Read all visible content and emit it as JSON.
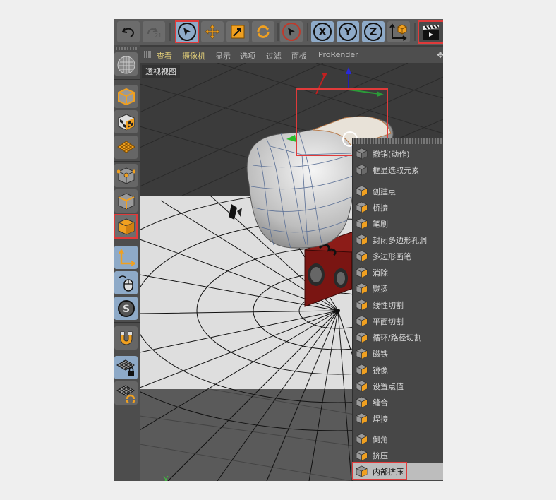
{
  "toolbar": {
    "undo_icon": "undo-icon",
    "redo_icon": "redo-icon",
    "tools": [
      "select-arrow-icon",
      "move-icon",
      "scale-icon",
      "rotate-icon",
      "live-select-icon"
    ],
    "axes": [
      "X",
      "Y",
      "Z"
    ],
    "coord_icon": "world-coordinate-icon",
    "render_icon": "clapper-render-icon"
  },
  "viewport_menu": {
    "items": [
      "查看",
      "摄像机",
      "显示",
      "选项",
      "过滤",
      "面板",
      "ProRender"
    ],
    "highlighted": [
      "查看",
      "摄像机"
    ]
  },
  "viewport": {
    "label": "透视视图"
  },
  "context_menu": {
    "groups": [
      [
        {
          "label": "撤销(动作)",
          "icon": "undo-action-icon"
        },
        {
          "label": "框显选取元素",
          "icon": "frame-selected-icon"
        }
      ],
      [
        {
          "label": "创建点",
          "icon": "create-point-icon"
        },
        {
          "label": "桥接",
          "icon": "bridge-icon"
        },
        {
          "label": "笔刷",
          "icon": "brush-icon"
        },
        {
          "label": "封闭多边形孔洞",
          "icon": "close-polygon-hole-icon"
        },
        {
          "label": "多边形画笔",
          "icon": "polygon-pen-icon"
        },
        {
          "label": "消除",
          "icon": "dissolve-icon"
        },
        {
          "label": "熨烫",
          "icon": "iron-icon"
        },
        {
          "label": "线性切割",
          "icon": "line-cut-icon"
        },
        {
          "label": "平面切割",
          "icon": "plane-cut-icon"
        },
        {
          "label": "循环/路径切割",
          "icon": "loop-path-cut-icon"
        },
        {
          "label": "磁铁",
          "icon": "magnet-icon"
        },
        {
          "label": "镜像",
          "icon": "mirror-icon"
        },
        {
          "label": "设置点值",
          "icon": "set-point-value-icon"
        },
        {
          "label": "缝合",
          "icon": "stitch-icon"
        },
        {
          "label": "焊接",
          "icon": "weld-icon"
        }
      ],
      [
        {
          "label": "倒角",
          "icon": "bevel-icon"
        },
        {
          "label": "挤压",
          "icon": "extrude-icon"
        },
        {
          "label": "内部挤压",
          "icon": "extrude-inner-icon",
          "selected": true
        }
      ]
    ]
  },
  "colors": {
    "accent_orange": "#f0a020",
    "highlight_red": "#e03a3a",
    "active_blue": "#8eaac8",
    "menu_highlight_yellow": "#e6d27a"
  }
}
